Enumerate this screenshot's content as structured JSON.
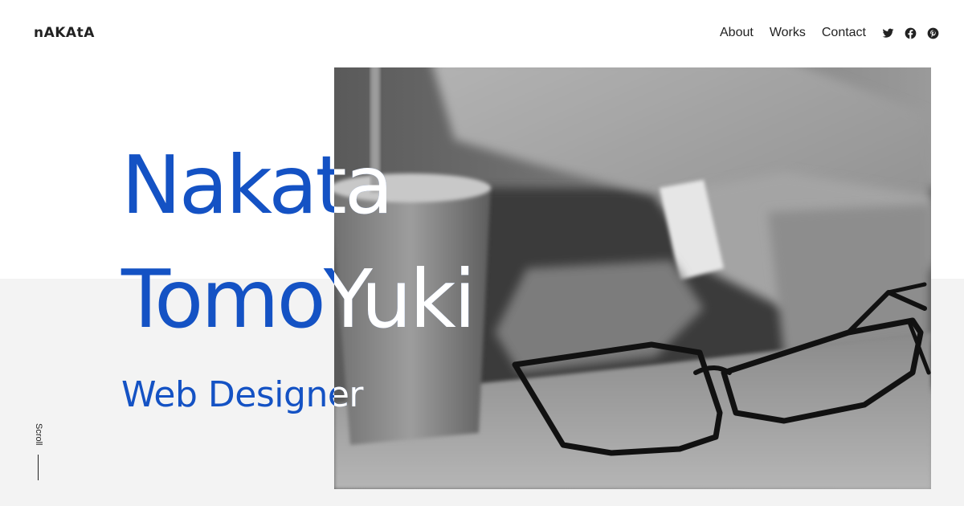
{
  "header": {
    "logo": "nAKAtA",
    "nav": [
      {
        "label": "About"
      },
      {
        "label": "Works"
      },
      {
        "label": "Contact"
      }
    ],
    "social": [
      {
        "icon": "twitter-icon"
      },
      {
        "icon": "facebook-icon"
      },
      {
        "icon": "pinterest-icon"
      }
    ]
  },
  "hero": {
    "line1": "Nakata",
    "line2": "TomoYuki",
    "subtitle": "Web Designer"
  },
  "scroll": {
    "label": "Scroll"
  },
  "colors": {
    "accent": "#1452c4",
    "band": "#f3f3f3",
    "text": "#222222"
  }
}
